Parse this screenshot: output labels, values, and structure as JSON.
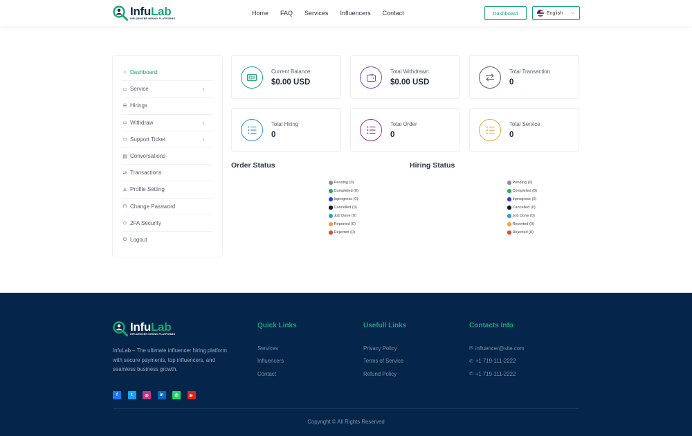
{
  "header": {
    "logo": {
      "name_prefix": "Infu",
      "name_suffix": "Lab",
      "tagline": "INFLUENCER HIRING PLATFORMS"
    },
    "nav": [
      "Home",
      "FAQ",
      "Services",
      "Influencers",
      "Contact"
    ],
    "dashboard_label": "Dashboard",
    "language": "English"
  },
  "sidebar": {
    "items": [
      {
        "label": "Dashboard",
        "icon": "home-icon",
        "active": true
      },
      {
        "label": "Service",
        "icon": "box-icon",
        "has_submenu": true
      },
      {
        "label": "Hirings",
        "icon": "list-icon"
      },
      {
        "label": "Withdraw",
        "icon": "wallet-icon",
        "has_submenu": true
      },
      {
        "label": "Support Ticket",
        "icon": "ticket-icon",
        "has_submenu": true
      },
      {
        "label": "Conversations",
        "icon": "chat-icon"
      },
      {
        "label": "Transactions",
        "icon": "exchange-icon"
      },
      {
        "label": "Profile Setting",
        "icon": "user-icon"
      },
      {
        "label": "Change Password",
        "icon": "lock-icon"
      },
      {
        "label": "2FA Security",
        "icon": "shield-icon"
      },
      {
        "label": "Logout",
        "icon": "power-icon"
      }
    ]
  },
  "stats": [
    {
      "label": "Current Balance",
      "value": "$0.00 USD",
      "icon": "money-icon",
      "color": "#17a673"
    },
    {
      "label": "Total Withdrawn",
      "value": "$0.00 USD",
      "icon": "wallet-icon",
      "color": "#7b4bb5"
    },
    {
      "label": "Total Transaction",
      "value": "0",
      "icon": "exchange-icon",
      "color": "#556170"
    },
    {
      "label": "Total Hiring",
      "value": "0",
      "icon": "list-icon",
      "color": "#2f8fd6"
    },
    {
      "label": "Total Order",
      "value": "0",
      "icon": "list-icon",
      "color": "#8e2f8e"
    },
    {
      "label": "Total Service",
      "value": "0",
      "icon": "checklist-icon",
      "color": "#f0a236"
    }
  ],
  "order_status": {
    "title": "Order Status",
    "legend": [
      {
        "label": "Pending (0)",
        "color": "#8a8f96"
      },
      {
        "label": "Completed (0)",
        "color": "#2eaa5a"
      },
      {
        "label": "Inprogress (0)",
        "color": "#3b3bd6"
      },
      {
        "label": "Cancelled (0)",
        "color": "#0c1a3a"
      },
      {
        "label": "Job Done (0)",
        "color": "#2f9fd6"
      },
      {
        "label": "Reported (0)",
        "color": "#f0a236"
      },
      {
        "label": "Rejected (0)",
        "color": "#e0483c"
      }
    ]
  },
  "hiring_status": {
    "title": "Hiring Status",
    "legend": [
      {
        "label": "Pending (0)",
        "color": "#8a8f96"
      },
      {
        "label": "Completed (0)",
        "color": "#2eaa5a"
      },
      {
        "label": "Inprogress (0)",
        "color": "#3b3bd6"
      },
      {
        "label": "Cancelled (0)",
        "color": "#0c1a3a"
      },
      {
        "label": "Job Done (0)",
        "color": "#2f9fd6"
      },
      {
        "label": "Reported (0)",
        "color": "#f0a236"
      },
      {
        "label": "Rejected (0)",
        "color": "#e0483c"
      }
    ]
  },
  "footer": {
    "description": "InfuLab – The ultimate influencer hiring platform with secure payments, top influencers, and seamless business growth.",
    "socials": [
      {
        "name": "facebook-icon",
        "glyph": "f",
        "color": "#1877f2"
      },
      {
        "name": "twitter-icon",
        "glyph": "t",
        "color": "#1da1f2"
      },
      {
        "name": "instagram-icon",
        "glyph": "◎",
        "color": "#c13584"
      },
      {
        "name": "linkedin-icon",
        "glyph": "in",
        "color": "#0a66c2"
      },
      {
        "name": "whatsapp-icon",
        "glyph": "✆",
        "color": "#25d366"
      },
      {
        "name": "youtube-icon",
        "glyph": "▶",
        "color": "#e62117"
      }
    ],
    "quick_links": {
      "title": "Quick Links",
      "links": [
        "Services",
        "Influencers",
        "Contact"
      ]
    },
    "useful_links": {
      "title": "Usefull Links",
      "links": [
        "Privacy Policy",
        "Terms of Service",
        "Refund Policy"
      ]
    },
    "contacts": {
      "title": "Contacts Info",
      "email": "influencer@site.com",
      "phone1": "+1 719-111-2222",
      "phone2": "+1 719-111-2222"
    },
    "copyright": "Copyright © All Rights Reserved"
  }
}
